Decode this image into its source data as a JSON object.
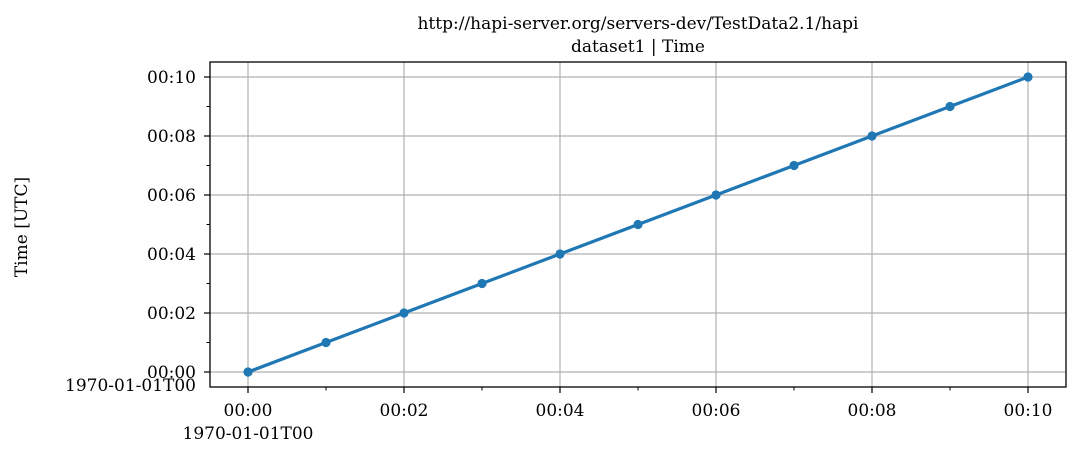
{
  "chart_data": {
    "type": "line",
    "title": "http://hapi-server.org/servers-dev/TestData2.1/hapi",
    "subtitle": "dataset1 | Time",
    "xlabel": "",
    "ylabel": "Time [UTC]",
    "x_reference_label": "1970-01-01T00",
    "y_reference_label": "1970-01-01T00",
    "xlim": [
      "1970-01-01T00:00:00",
      "1970-01-01T00:10:00"
    ],
    "ylim": [
      "1970-01-01T00:00:00",
      "1970-01-01T00:10:00"
    ],
    "x_ticks": [
      "00:00",
      "00:02",
      "00:04",
      "00:06",
      "00:08",
      "00:10"
    ],
    "y_ticks": [
      "00:00",
      "00:02",
      "00:04",
      "00:06",
      "00:08",
      "00:10"
    ],
    "grid": true,
    "legend": "none",
    "color": "#1f77b4",
    "x": [
      "1970-01-01T00:00:00",
      "1970-01-01T00:01:00",
      "1970-01-01T00:02:00",
      "1970-01-01T00:03:00",
      "1970-01-01T00:04:00",
      "1970-01-01T00:05:00",
      "1970-01-01T00:06:00",
      "1970-01-01T00:07:00",
      "1970-01-01T00:08:00",
      "1970-01-01T00:09:00",
      "1970-01-01T00:10:00"
    ],
    "series": [
      {
        "values": [
          "1970-01-01T00:00:00",
          "1970-01-01T00:01:00",
          "1970-01-01T00:02:00",
          "1970-01-01T00:03:00",
          "1970-01-01T00:04:00",
          "1970-01-01T00:05:00",
          "1970-01-01T00:06:00",
          "1970-01-01T00:07:00",
          "1970-01-01T00:08:00",
          "1970-01-01T00:09:00",
          "1970-01-01T00:10:00"
        ]
      }
    ]
  }
}
